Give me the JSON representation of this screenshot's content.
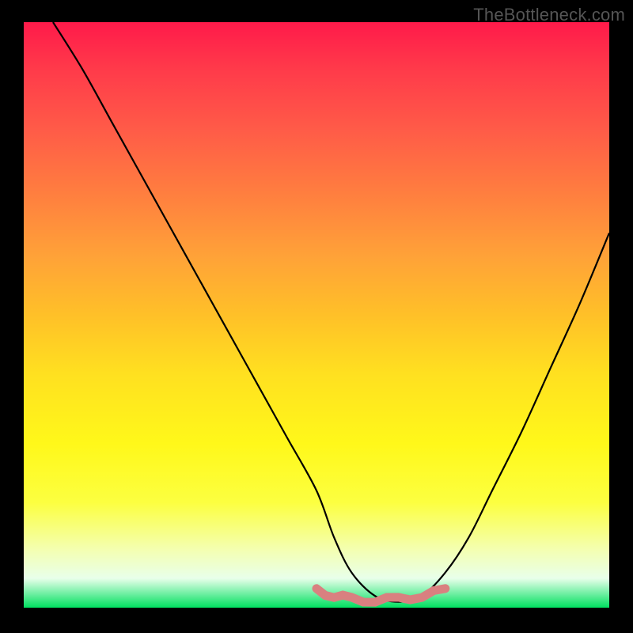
{
  "watermark": "TheBottleneck.com",
  "chart_data": {
    "type": "line",
    "title": "",
    "xlabel": "",
    "ylabel": "",
    "xlim": [
      0,
      100
    ],
    "ylim": [
      0,
      100
    ],
    "series": [
      {
        "name": "black-curve",
        "color": "#000000",
        "x": [
          5,
          10,
          15,
          20,
          25,
          30,
          35,
          40,
          45,
          50,
          53,
          56,
          60,
          64,
          68,
          72,
          76,
          80,
          85,
          90,
          95,
          100
        ],
        "y": [
          100,
          92,
          83,
          74,
          65,
          56,
          47,
          38,
          29,
          20,
          12,
          6,
          2,
          1,
          2,
          6,
          12,
          20,
          30,
          41,
          52,
          64
        ]
      },
      {
        "name": "pink-bottom-band",
        "color": "#d98080",
        "x": [
          50,
          53,
          56,
          60,
          64,
          68,
          72
        ],
        "y": [
          3,
          2,
          1.5,
          1.2,
          1.5,
          2,
          3
        ]
      }
    ],
    "annotations": []
  },
  "colors": {
    "background_frame": "#000000",
    "watermark": "#555555",
    "gradient_top": "#ff1a4a",
    "gradient_bottom": "#00e060",
    "curve": "#000000",
    "bottom_squiggle": "#d98080"
  }
}
